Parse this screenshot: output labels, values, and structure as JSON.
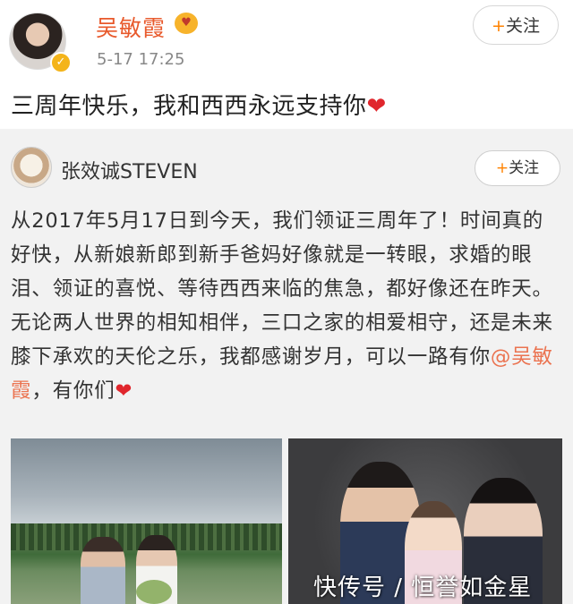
{
  "post": {
    "author": "吴敏霞",
    "time": "5-17 17:25",
    "follow_plus": "+",
    "follow_label": "关注",
    "text": "三周年快乐，我和西西永远支持你",
    "heart": "❤"
  },
  "repost": {
    "author": "张效诚STEVEN",
    "follow_plus": "+",
    "follow_label": "关注",
    "text_before_mention": "从2017年5月17日到今天，我们领证三周年了！时间真的好快，从新娘新郎到新手爸妈好像就是一转眼，求婚的眼泪、领证的喜悦、等待西西来临的焦急，都好像还在昨天。无论两人世界的相知相伴，三口之家的相爱相守，还是未来膝下承欢的天伦之乐，我都感谢岁月，可以一路有你",
    "mention": "@吴敏霞",
    "text_after_mention": "，有你们",
    "heart": "❤"
  },
  "watermark": "快传号 / 恒誉如金星",
  "icons": {
    "verified": "verified-badge-icon",
    "member": "member-badge-icon"
  },
  "colors": {
    "name_orange": "#e8592b",
    "follow_orange": "#ff8200",
    "mention": "#eb7350",
    "heart": "#e0262c"
  }
}
